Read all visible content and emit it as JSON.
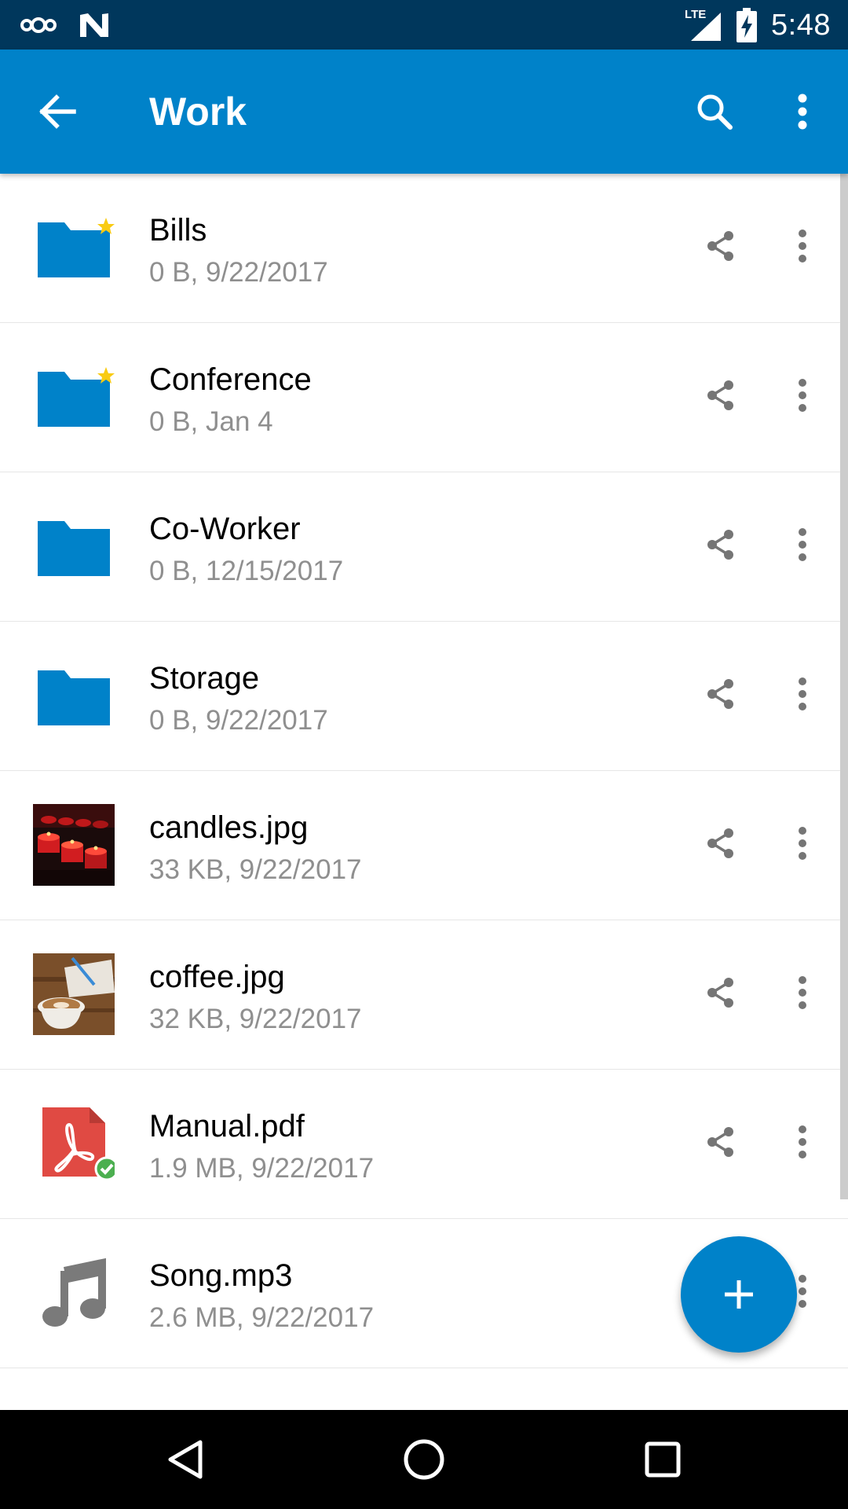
{
  "status_bar": {
    "time": "5:48",
    "network": "LTE",
    "icons": [
      "cloud-icon",
      "n-logo-icon",
      "signal-icon",
      "battery-charging-icon"
    ]
  },
  "app_bar": {
    "title": "Work",
    "icons": [
      "back-arrow-icon",
      "search-icon",
      "overflow-menu-icon"
    ]
  },
  "files": [
    {
      "name": "Bills",
      "meta": "0 B, 9/22/2017",
      "type": "folder",
      "favorite": true
    },
    {
      "name": "Conference",
      "meta": "0 B, Jan 4",
      "type": "folder",
      "favorite": true
    },
    {
      "name": "Co-Worker",
      "meta": "0 B, 12/15/2017",
      "type": "folder",
      "favorite": false
    },
    {
      "name": "Storage",
      "meta": "0 B, 9/22/2017",
      "type": "folder",
      "favorite": false
    },
    {
      "name": "candles.jpg",
      "meta": "33 KB, 9/22/2017",
      "type": "image",
      "favorite": false
    },
    {
      "name": "coffee.jpg",
      "meta": "32 KB, 9/22/2017",
      "type": "image",
      "favorite": false
    },
    {
      "name": "Manual.pdf",
      "meta": "1.9 MB, 9/22/2017",
      "type": "pdf",
      "synced": true
    },
    {
      "name": "Song.mp3",
      "meta": "2.6 MB, 9/22/2017",
      "type": "audio"
    }
  ],
  "fab": {
    "icon": "plus-icon"
  },
  "colors": {
    "status_bar": "#00375c",
    "app_bar": "#0082c9",
    "folder": "#0082c9",
    "favorite_star": "#f9cb13",
    "pdf": "#e04a43",
    "sync_ok": "#4caf50",
    "meta_text": "#8f8f8f"
  }
}
